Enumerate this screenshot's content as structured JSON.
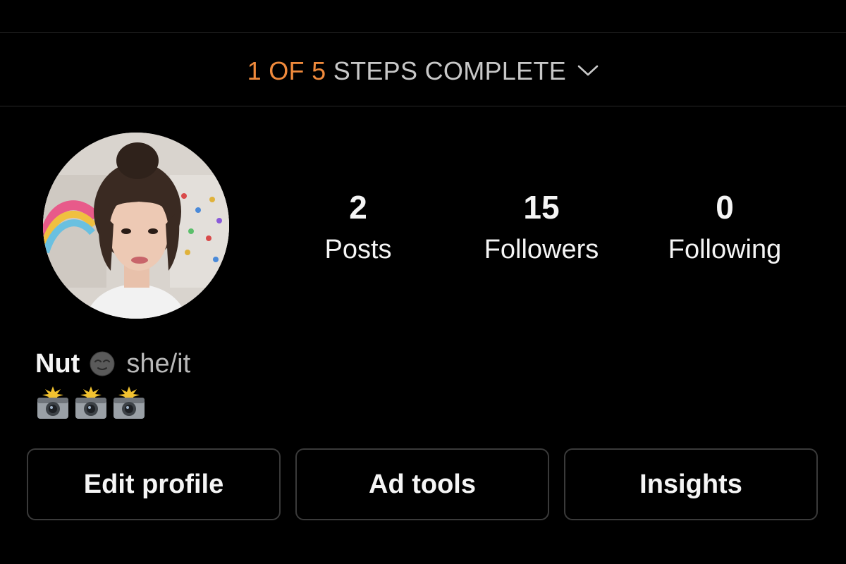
{
  "setup_banner": {
    "progress": "1 OF 5",
    "label": " STEPS COMPLETE",
    "progress_color": "#f08a3c",
    "icon": "chevron-down-icon"
  },
  "profile": {
    "avatar_alt": "profile picture",
    "name": "Nut",
    "name_emoji": "new-moon-with-face-icon",
    "pronouns": "she/it",
    "bio_emojis": [
      "camera-with-flash-icon",
      "camera-with-flash-icon",
      "camera-with-flash-icon"
    ]
  },
  "stats": [
    {
      "value": "2",
      "label": "Posts"
    },
    {
      "value": "15",
      "label": "Followers"
    },
    {
      "value": "0",
      "label": "Following"
    }
  ],
  "actions": {
    "edit_profile": "Edit profile",
    "ad_tools": "Ad tools",
    "insights": "Insights"
  }
}
